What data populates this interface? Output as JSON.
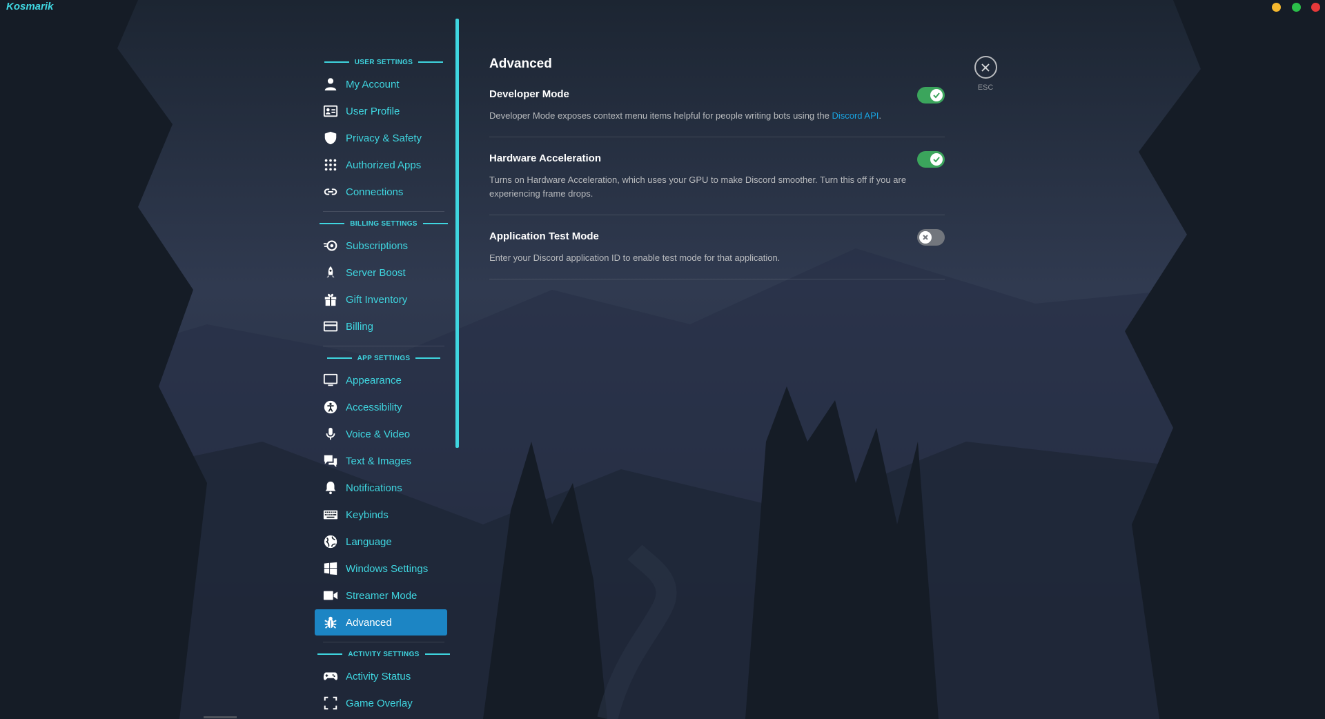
{
  "app": {
    "name": "Kosmarik"
  },
  "sidebar": {
    "sections": [
      {
        "header": "USER SETTINGS",
        "items": [
          {
            "label": "My Account",
            "icon": "user-icon"
          },
          {
            "label": "User Profile",
            "icon": "id-card-icon"
          },
          {
            "label": "Privacy & Safety",
            "icon": "shield-icon"
          },
          {
            "label": "Authorized Apps",
            "icon": "grid-icon"
          },
          {
            "label": "Connections",
            "icon": "link-icon"
          }
        ]
      },
      {
        "header": "BILLING SETTINGS",
        "items": [
          {
            "label": "Subscriptions",
            "icon": "nitro-icon"
          },
          {
            "label": "Server Boost",
            "icon": "boost-icon"
          },
          {
            "label": "Gift Inventory",
            "icon": "gift-icon"
          },
          {
            "label": "Billing",
            "icon": "credit-card-icon"
          }
        ]
      },
      {
        "header": "APP SETTINGS",
        "items": [
          {
            "label": "Appearance",
            "icon": "monitor-icon"
          },
          {
            "label": "Accessibility",
            "icon": "accessibility-icon"
          },
          {
            "label": "Voice & Video",
            "icon": "microphone-icon"
          },
          {
            "label": "Text & Images",
            "icon": "chat-bubbles-icon"
          },
          {
            "label": "Notifications",
            "icon": "bell-icon"
          },
          {
            "label": "Keybinds",
            "icon": "keyboard-icon"
          },
          {
            "label": "Language",
            "icon": "globe-icon"
          },
          {
            "label": "Windows Settings",
            "icon": "windows-icon"
          },
          {
            "label": "Streamer Mode",
            "icon": "camera-icon"
          },
          {
            "label": "Advanced",
            "icon": "bug-icon",
            "active": true
          }
        ]
      },
      {
        "header": "ACTIVITY SETTINGS",
        "items": [
          {
            "label": "Activity Status",
            "icon": "gamepad-icon"
          },
          {
            "label": "Game Overlay",
            "icon": "overlay-icon"
          }
        ]
      }
    ]
  },
  "main": {
    "title": "Advanced",
    "settings": [
      {
        "title": "Developer Mode",
        "description": "Developer Mode exposes context menu items helpful for people writing bots using the ",
        "link_text": "Discord API",
        "description_suffix": ".",
        "enabled": true
      },
      {
        "title": "Hardware Acceleration",
        "description": "Turns on Hardware Acceleration, which uses your GPU to make Discord smoother. Turn this off if you are experiencing frame drops.",
        "enabled": true
      },
      {
        "title": "Application Test Mode",
        "description": "Enter your Discord application ID to enable test mode for that application.",
        "enabled": false
      }
    ]
  },
  "close": {
    "label": "ESC",
    "icon": "close-icon"
  },
  "colors": {
    "accent": "#3fd6e0",
    "active_bg": "#1c85c4",
    "toggle_on": "#3ba55c",
    "toggle_off": "#72767d",
    "link": "#19a3e0"
  }
}
